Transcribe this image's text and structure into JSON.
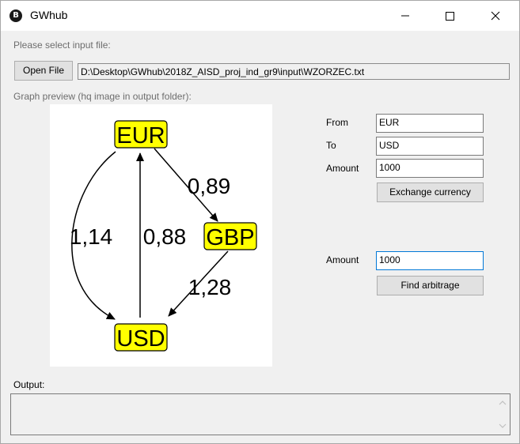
{
  "window": {
    "title": "GWhub",
    "app_icon_glyph": "B"
  },
  "file": {
    "prompt_label": "Please select input file:",
    "open_button_label": "Open File",
    "path_value": "D:\\Desktop\\GWhub\\2018Z_AISD_proj_ind_gr9\\input\\WZORZEC.txt"
  },
  "graph": {
    "label": "Graph preview (hq image in output folder):",
    "nodes": [
      "EUR",
      "GBP",
      "USD"
    ],
    "edge_labels": {
      "eur_gbp": "0,89",
      "eur_usd": "1,14",
      "usd_eur": "0,88",
      "gbp_usd": "1,28"
    },
    "node_fill": "#ffff00"
  },
  "exchange": {
    "from_label": "From",
    "from_value": "EUR",
    "to_label": "To",
    "to_value": "USD",
    "amount_label": "Amount",
    "amount_value": "1000",
    "button_label": "Exchange currency"
  },
  "arbitrage": {
    "amount_label": "Amount",
    "amount_value": "1000",
    "button_label": "Find arbitrage"
  },
  "output": {
    "label": "Output:",
    "value": ""
  }
}
